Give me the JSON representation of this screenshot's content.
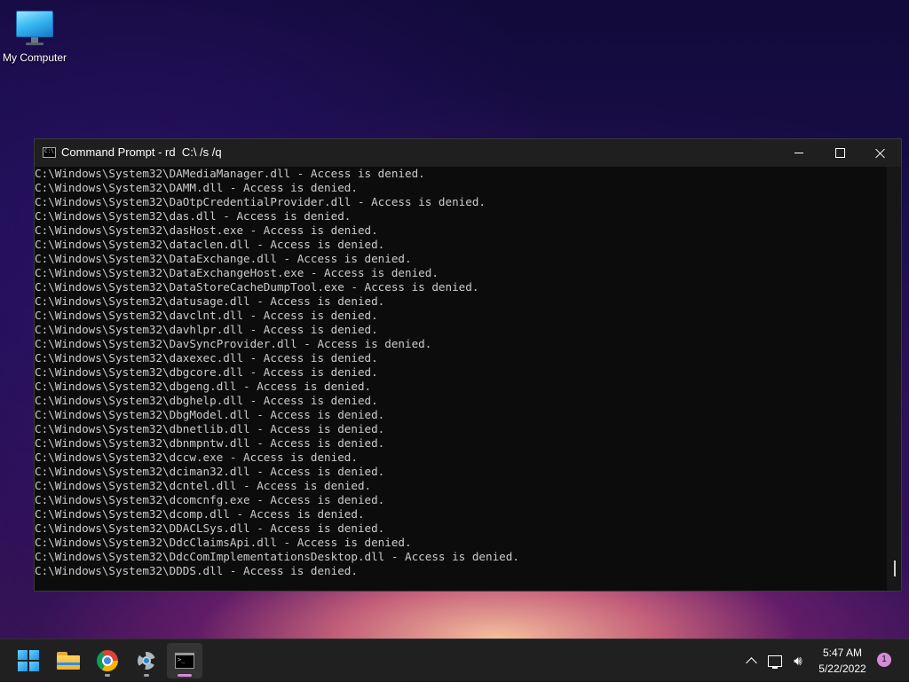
{
  "desktop": {
    "icons": [
      {
        "label": "My Computer",
        "icon": "computer-icon"
      }
    ]
  },
  "window": {
    "title": "Command Prompt - rd  C:\\ /s /q",
    "console_lines": [
      "C:\\Windows\\System32\\DAMediaManager.dll - Access is denied.",
      "C:\\Windows\\System32\\DAMM.dll - Access is denied.",
      "C:\\Windows\\System32\\DaOtpCredentialProvider.dll - Access is denied.",
      "C:\\Windows\\System32\\das.dll - Access is denied.",
      "C:\\Windows\\System32\\dasHost.exe - Access is denied.",
      "C:\\Windows\\System32\\dataclen.dll - Access is denied.",
      "C:\\Windows\\System32\\DataExchange.dll - Access is denied.",
      "C:\\Windows\\System32\\DataExchangeHost.exe - Access is denied.",
      "C:\\Windows\\System32\\DataStoreCacheDumpTool.exe - Access is denied.",
      "C:\\Windows\\System32\\datusage.dll - Access is denied.",
      "C:\\Windows\\System32\\davclnt.dll - Access is denied.",
      "C:\\Windows\\System32\\davhlpr.dll - Access is denied.",
      "C:\\Windows\\System32\\DavSyncProvider.dll - Access is denied.",
      "C:\\Windows\\System32\\daxexec.dll - Access is denied.",
      "C:\\Windows\\System32\\dbgcore.dll - Access is denied.",
      "C:\\Windows\\System32\\dbgeng.dll - Access is denied.",
      "C:\\Windows\\System32\\dbghelp.dll - Access is denied.",
      "C:\\Windows\\System32\\DbgModel.dll - Access is denied.",
      "C:\\Windows\\System32\\dbnetlib.dll - Access is denied.",
      "C:\\Windows\\System32\\dbnmpntw.dll - Access is denied.",
      "C:\\Windows\\System32\\dccw.exe - Access is denied.",
      "C:\\Windows\\System32\\dciman32.dll - Access is denied.",
      "C:\\Windows\\System32\\dcntel.dll - Access is denied.",
      "C:\\Windows\\System32\\dcomcnfg.exe - Access is denied.",
      "C:\\Windows\\System32\\dcomp.dll - Access is denied.",
      "C:\\Windows\\System32\\DDACLSys.dll - Access is denied.",
      "C:\\Windows\\System32\\DdcClaimsApi.dll - Access is denied.",
      "C:\\Windows\\System32\\DdcComImplementationsDesktop.dll - Access is denied.",
      "C:\\Windows\\System32\\DDDS.dll - Access is denied."
    ]
  },
  "taskbar": {
    "apps": [
      {
        "name": "start",
        "icon": "windows-logo-icon"
      },
      {
        "name": "file-explorer",
        "icon": "folder-icon"
      },
      {
        "name": "chrome",
        "icon": "chrome-icon"
      },
      {
        "name": "settings",
        "icon": "gear-icon"
      },
      {
        "name": "command-prompt",
        "icon": "cmd-icon"
      }
    ],
    "clock": {
      "time": "5:47 AM",
      "date": "5/22/2022"
    },
    "notification_count": "1"
  },
  "colors": {
    "console_bg": "#0c0c0c",
    "console_text": "#cccccc",
    "titlebar_bg": "#1f1f1f",
    "taskbar_bg": "#202020",
    "accent": "#d58bd8"
  }
}
